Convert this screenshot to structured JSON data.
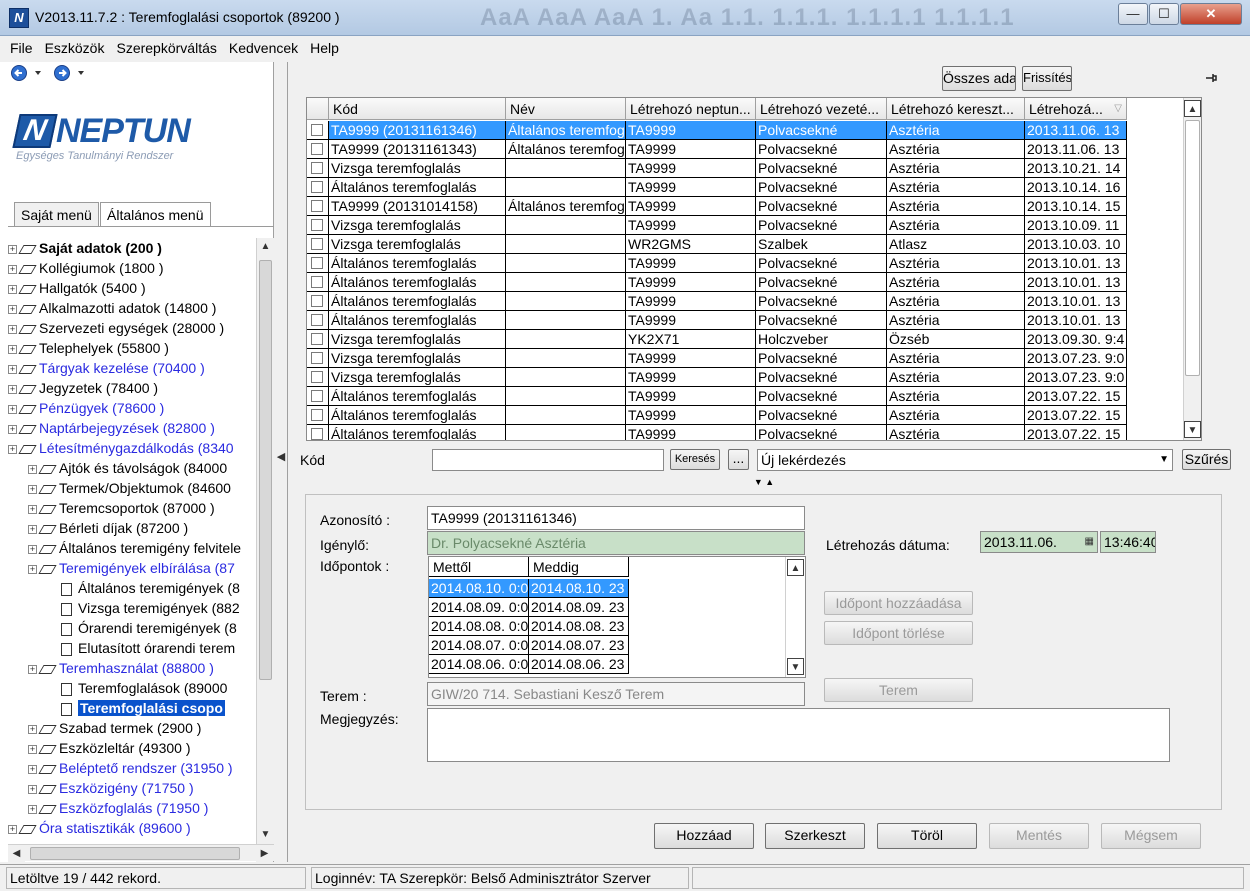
{
  "window": {
    "title": "V2013.11.7.2 : Teremfoglalási csoportok (89200 )",
    "ribbon_ghost": "AaA AaA AaA 1. Aa 1.1. 1.1.1. 1.1.1.1 1.1.1.1",
    "buttons": {
      "minimize": "—",
      "maximize": "☐",
      "close": "✕"
    }
  },
  "menu": [
    "File",
    "Eszközök",
    "Szerepkörváltás",
    "Kedvencek",
    "Help"
  ],
  "logo": {
    "main": "NEPTUN",
    "sub": "Egységes Tanulmányi Rendszer",
    "mark": "N"
  },
  "tabs": [
    "Saját menü",
    "Általános menü"
  ],
  "tree": [
    {
      "label": "Saját adatok (200  )",
      "style": "bold",
      "level": 0,
      "icon": "diamond"
    },
    {
      "label": "Kollégiumok (1800  )",
      "style": "normal",
      "level": 0,
      "icon": "diamond"
    },
    {
      "label": "Hallgatók (5400  )",
      "style": "normal",
      "level": 0,
      "icon": "diamond"
    },
    {
      "label": "Alkalmazotti adatok (14800  )",
      "style": "normal",
      "level": 0,
      "icon": "diamond"
    },
    {
      "label": "Szervezeti egységek (28000  )",
      "style": "normal",
      "level": 0,
      "icon": "diamond"
    },
    {
      "label": "Telephelyek (55800  )",
      "style": "normal",
      "level": 0,
      "icon": "diamond"
    },
    {
      "label": "Tárgyak kezelése (70400  )",
      "style": "blue",
      "level": 0,
      "icon": "diamond"
    },
    {
      "label": "Jegyzetek (78400  )",
      "style": "normal",
      "level": 0,
      "icon": "diamond"
    },
    {
      "label": "Pénzügyek (78600  )",
      "style": "blue",
      "level": 0,
      "icon": "diamond"
    },
    {
      "label": "Naptárbejegyzések (82800  )",
      "style": "blue",
      "level": 0,
      "icon": "diamond"
    },
    {
      "label": "Létesítménygazdálkodás (8340",
      "style": "blue",
      "level": 0,
      "icon": "diamond"
    },
    {
      "label": "Ajtók és távolságok (84000",
      "style": "normal",
      "level": 1,
      "icon": "diamond"
    },
    {
      "label": "Termek/Objektumok (84600",
      "style": "normal",
      "level": 1,
      "icon": "diamond"
    },
    {
      "label": "Teremcsoportok (87000  )",
      "style": "normal",
      "level": 1,
      "icon": "diamond"
    },
    {
      "label": "Bérleti díjak (87200  )",
      "style": "normal",
      "level": 1,
      "icon": "diamond"
    },
    {
      "label": "Általános teremigény felvitele",
      "style": "normal",
      "level": 1,
      "icon": "diamond"
    },
    {
      "label": "Teremigények elbírálása (87",
      "style": "blue",
      "level": 1,
      "icon": "diamond"
    },
    {
      "label": "Általános teremigények (8",
      "style": "normal",
      "level": 2,
      "icon": "page"
    },
    {
      "label": "Vizsga teremigények (882",
      "style": "normal",
      "level": 2,
      "icon": "page"
    },
    {
      "label": "Órarendi teremigények (8",
      "style": "normal",
      "level": 2,
      "icon": "page"
    },
    {
      "label": "Elutasított órarendi terem",
      "style": "normal",
      "level": 2,
      "icon": "page"
    },
    {
      "label": "Teremhasználat (88800  )",
      "style": "blue",
      "level": 1,
      "icon": "diamond"
    },
    {
      "label": "Teremfoglalások (89000",
      "style": "normal",
      "level": 2,
      "icon": "page"
    },
    {
      "label": "Teremfoglalási csopo",
      "style": "selected",
      "level": 2,
      "icon": "page"
    },
    {
      "label": "Szabad termek (2900  )",
      "style": "normal",
      "level": 1,
      "icon": "diamond"
    },
    {
      "label": "Eszközleltár (49300  )",
      "style": "normal",
      "level": 1,
      "icon": "diamond"
    },
    {
      "label": "Beléptető rendszer (31950  )",
      "style": "blue",
      "level": 1,
      "icon": "diamond"
    },
    {
      "label": "Eszközigény (71750  )",
      "style": "blue",
      "level": 1,
      "icon": "diamond"
    },
    {
      "label": "Eszközfoglalás (71950  )",
      "style": "blue",
      "level": 1,
      "icon": "diamond"
    },
    {
      "label": "Óra statisztikák (89600  )",
      "style": "blue",
      "level": 0,
      "icon": "diamond"
    }
  ],
  "toolbar": {
    "all_data": "Összes ada",
    "refresh": "Frissítés",
    "pin": "📌"
  },
  "grid": {
    "columns": [
      "Kód",
      "Név",
      "Létrehozó neptun...",
      "Létrehozó vezeté...",
      "Létrehozó kereszt...",
      "Létrehozá..."
    ],
    "rows": [
      [
        "TA9999 (20131161346)",
        "Általános teremfoglalás",
        "TA9999",
        "Polvacsekné",
        "Asztéria",
        "2013.11.06. 13"
      ],
      [
        "TA9999 (20131161343)",
        "Általános teremfoglalás",
        "TA9999",
        "Polvacsekné",
        "Asztéria",
        "2013.11.06. 13"
      ],
      [
        "Vizsga teremfoglalás",
        "",
        "TA9999",
        "Polvacsekné",
        "Asztéria",
        "2013.10.21. 14"
      ],
      [
        "Általános teremfoglalás",
        "",
        "TA9999",
        "Polvacsekné",
        "Asztéria",
        "2013.10.14. 16"
      ],
      [
        "TA9999 (20131014158)",
        "Általános teremfoglalás",
        "TA9999",
        "Polvacsekné",
        "Asztéria",
        "2013.10.14. 15"
      ],
      [
        "Vizsga teremfoglalás",
        "",
        "TA9999",
        "Polvacsekné",
        "Asztéria",
        "2013.10.09. 11"
      ],
      [
        "Vizsga teremfoglalás",
        "",
        "WR2GMS",
        "Szalbek",
        "Atlasz",
        "2013.10.03. 10"
      ],
      [
        "Általános teremfoglalás",
        "",
        "TA9999",
        "Polvacsekné",
        "Asztéria",
        "2013.10.01. 13"
      ],
      [
        "Általános teremfoglalás",
        "",
        "TA9999",
        "Polvacsekné",
        "Asztéria",
        "2013.10.01. 13"
      ],
      [
        "Általános teremfoglalás",
        "",
        "TA9999",
        "Polvacsekné",
        "Asztéria",
        "2013.10.01. 13"
      ],
      [
        "Általános teremfoglalás",
        "",
        "TA9999",
        "Polvacsekné",
        "Asztéria",
        "2013.10.01. 13"
      ],
      [
        "Vizsga teremfoglalás",
        "",
        "YK2X71",
        "Holczveber",
        "Özséb",
        "2013.09.30. 9:4"
      ],
      [
        "Vizsga teremfoglalás",
        "",
        "TA9999",
        "Polvacsekné",
        "Asztéria",
        "2013.07.23. 9:0"
      ],
      [
        "Vizsga teremfoglalás",
        "",
        "TA9999",
        "Polvacsekné",
        "Asztéria",
        "2013.07.23. 9:0"
      ],
      [
        "Általános teremfoglalás",
        "",
        "TA9999",
        "Polvacsekné",
        "Asztéria",
        "2013.07.22. 15"
      ],
      [
        "Általános teremfoglalás",
        "",
        "TA9999",
        "Polvacsekné",
        "Asztéria",
        "2013.07.22. 15"
      ],
      [
        "Általános teremfoglalás",
        "",
        "TA9999",
        "Polvacsekné",
        "Asztéria",
        "2013.07.22. 15"
      ]
    ]
  },
  "search": {
    "label": "Kód",
    "value": "",
    "search_btn": "Keresés",
    "ellipsis": "...",
    "query": "Új lekérdezés",
    "filter_btn": "Szűrés"
  },
  "detail": {
    "azonosito_label": "Azonosító :",
    "azonosito": "TA9999 (20131161346)",
    "igenylo_label": "Igénylő:",
    "igenylo": "Dr. Polyacsekné Asztéria",
    "letrehozas_label": "Létrehozás dátuma:",
    "letrehozas_date": "2013.11.06.",
    "letrehozas_time": "13:46:40",
    "idopontok_label": "Időpontok :",
    "times_columns": [
      "Mettől",
      "Meddig"
    ],
    "times": [
      [
        "2014.08.10. 0:0",
        "2014.08.10. 23"
      ],
      [
        "2014.08.09. 0:0",
        "2014.08.09. 23"
      ],
      [
        "2014.08.08. 0:0",
        "2014.08.08. 23"
      ],
      [
        "2014.08.07. 0:0",
        "2014.08.07. 23"
      ],
      [
        "2014.08.06. 0:0",
        "2014.08.06. 23"
      ]
    ],
    "add_time_btn": "Időpont hozzáadása",
    "delete_time_btn": "Időpont törlése",
    "terem_label": "Terem :",
    "terem": "GIW/20 714. Sebastiani Kesző Terem",
    "terem_btn": "Terem",
    "megjegyzes_label": "Megjegyzés:",
    "megjegyzes": ""
  },
  "actions": {
    "add": "Hozzáad",
    "edit": "Szerkeszt",
    "delete": "Töröl",
    "save": "Mentés",
    "cancel": "Mégsem"
  },
  "status": {
    "loaded": "Letöltve 19 / 442 rekord.",
    "login": "Loginnév: TA  Szerepkör: Belső Adminisztrátor  Szerver"
  }
}
